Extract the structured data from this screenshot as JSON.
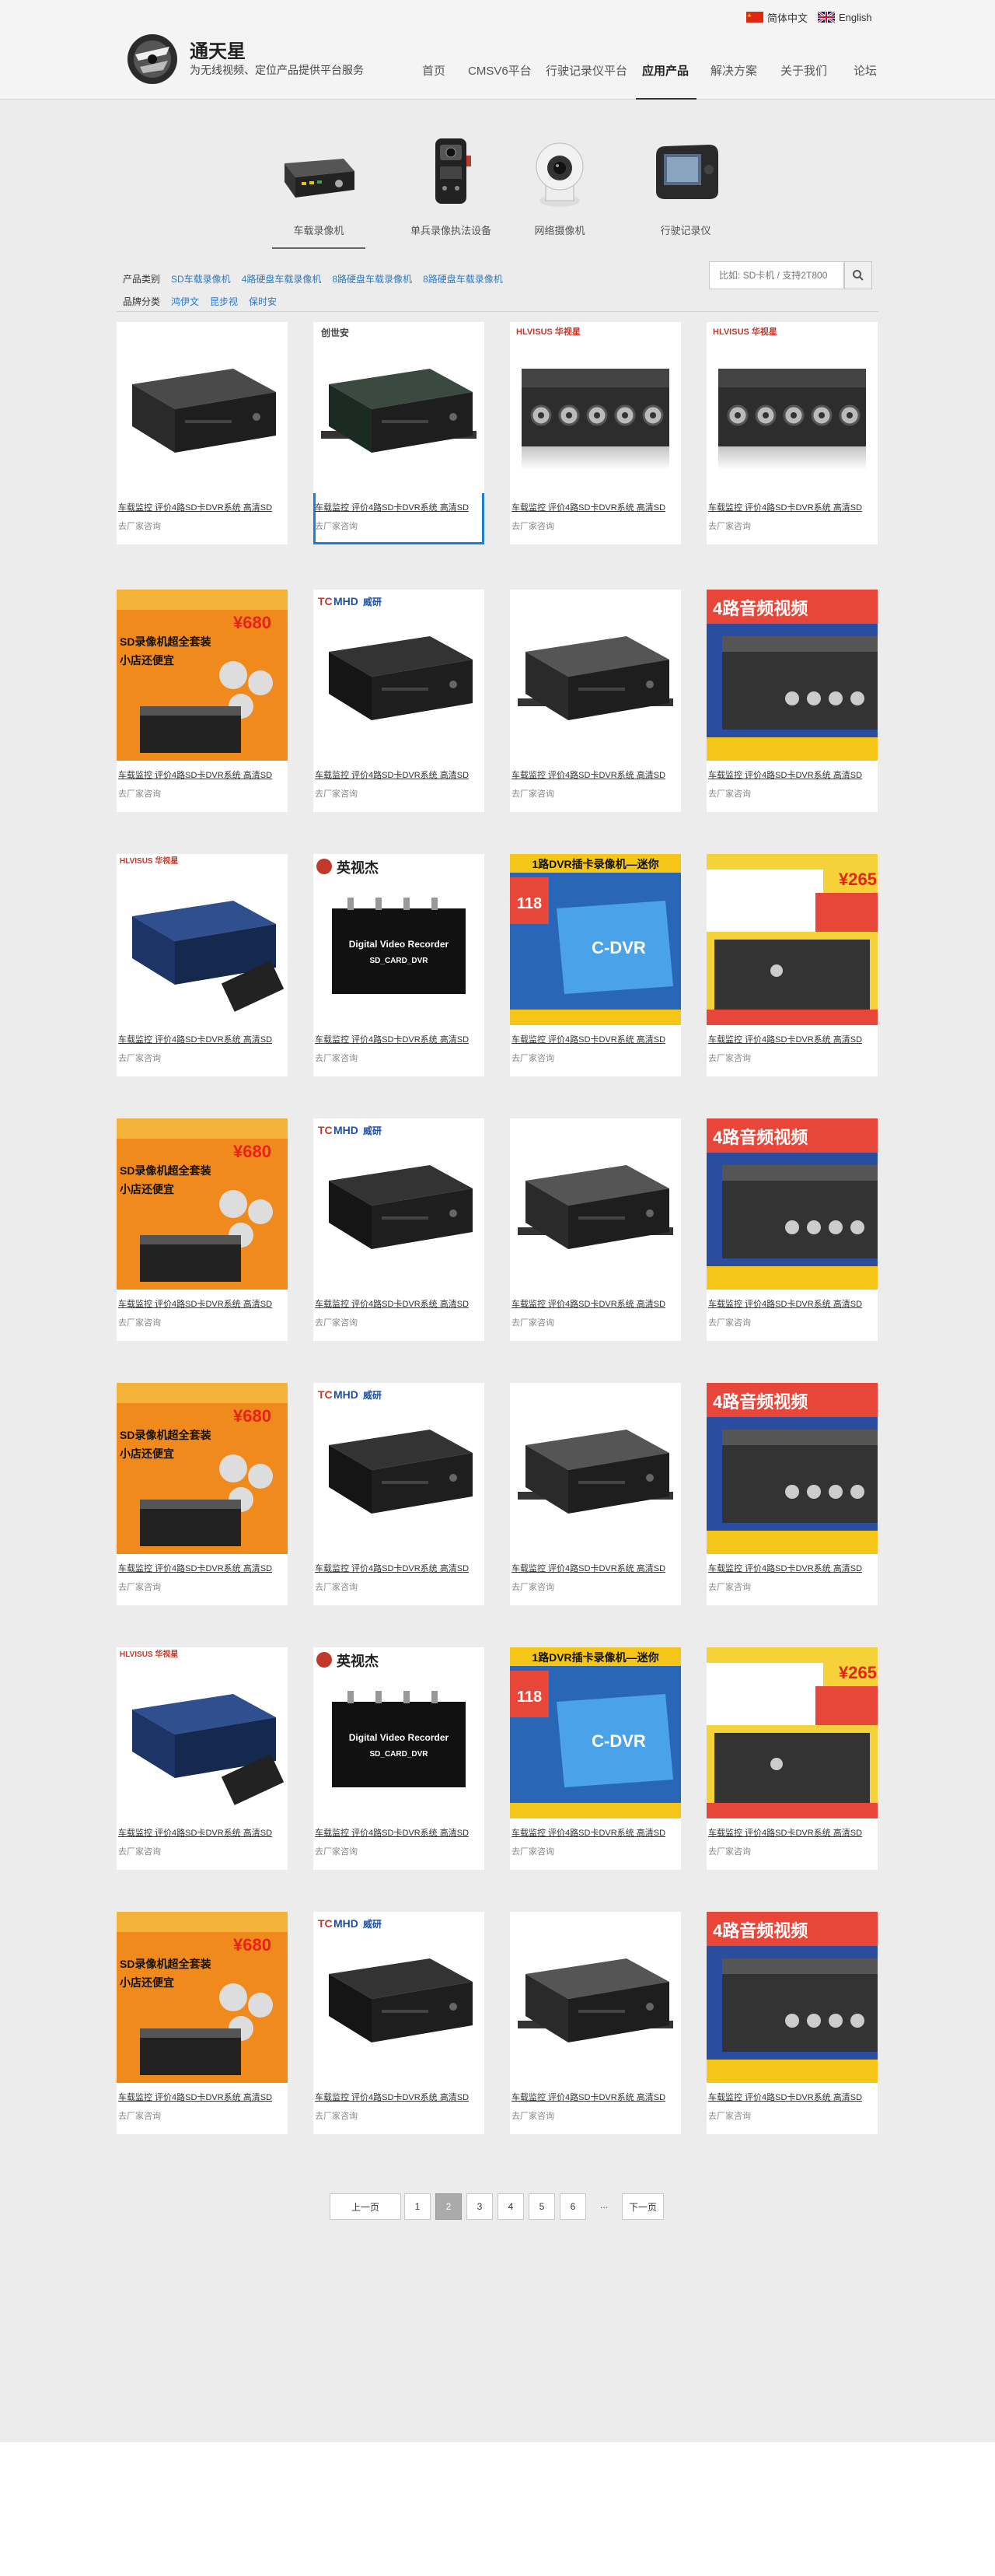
{
  "header": {
    "brand_name": "通天星",
    "brand_slogan": "为无线视频、定位产品提供平台服务",
    "lang_cn": "简体中文",
    "lang_en": "English",
    "nav": [
      "首页",
      "CMSV6平台",
      "行驶记录仪平台",
      "应用产品",
      "解决方案",
      "关于我们",
      "论坛"
    ],
    "active_nav": "应用产品"
  },
  "categories": [
    {
      "label": "车载录像机",
      "icon": "mobile-dvr-icon"
    },
    {
      "label": "单兵录像执法设备",
      "icon": "body-camera-icon"
    },
    {
      "label": "网络摄像机",
      "icon": "ip-camera-icon"
    },
    {
      "label": "行驶记录仪",
      "icon": "dashcam-icon"
    }
  ],
  "filter": {
    "type_label": "产品类别",
    "types": [
      "SD车载录像机",
      "4路硬盘车载录像机",
      "8路硬盘车载录像机",
      "8路硬盘车载录像机"
    ],
    "brand_label": "品牌分类",
    "brands": [
      "鸿伊文",
      "昆步视",
      "保时安"
    ],
    "search_placeholder": "比如: SD卡机 / 支持2T800"
  },
  "product": {
    "title": "车载监控 评价4路SD卡DVR系统 高清SD",
    "subtitle": "去厂家咨询"
  },
  "pagination": {
    "prev": "上一页",
    "pages": [
      "1",
      "2",
      "3",
      "4",
      "5",
      "6"
    ],
    "active": "2",
    "ellipsis": "...",
    "next": "下一页"
  },
  "promo": {
    "price_680": "¥680",
    "price_265": "¥265",
    "price_118": "118",
    "four_channel": "4路音频视频",
    "dvr_banner": "1路DVR插卡录像机—迷你",
    "cdvr": "C-DVR",
    "sd_kit": "SD录像机超全套装",
    "small_shop": "小店还便宜",
    "dvr_name": "Digital Video Recorder",
    "dvr_sub": "SD_CARD_DVR",
    "brand_cms": "MHD",
    "brand_wei": "威研",
    "brand_ying": "英视杰",
    "brand_hlv": "HLVISUS 华视星",
    "brand_cs": "创世安"
  }
}
